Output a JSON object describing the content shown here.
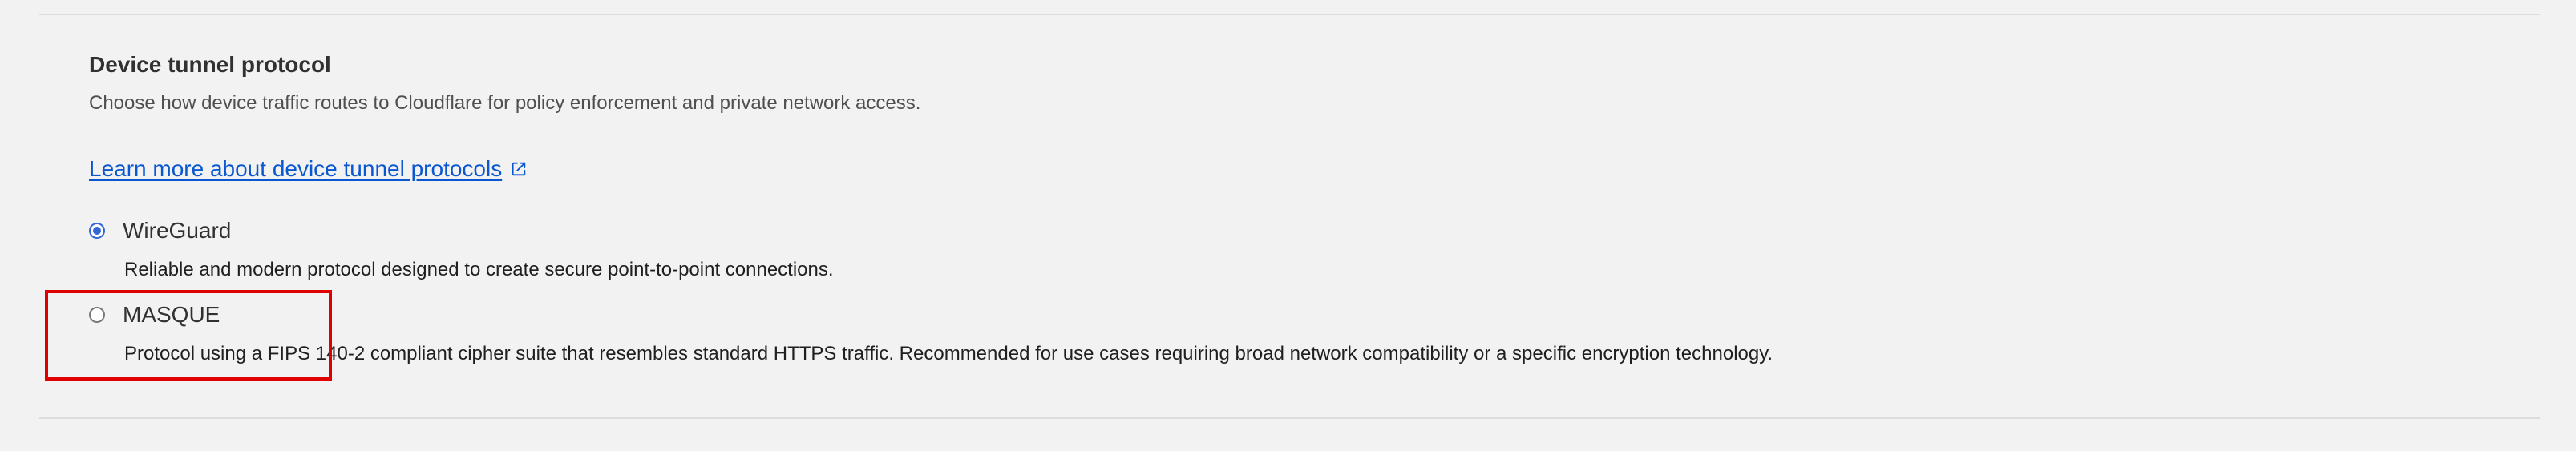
{
  "section": {
    "title": "Device tunnel protocol",
    "subtitle": "Choose how device traffic routes to Cloudflare for policy enforcement and private network access.",
    "learn_more": "Learn more about device tunnel protocols"
  },
  "options": [
    {
      "label": "WireGuard",
      "description": "Reliable and modern protocol designed to create secure point-to-point connections.",
      "selected": true
    },
    {
      "label": "MASQUE",
      "description": "Protocol using a FIPS 140-2 compliant cipher suite that resembles standard HTTPS traffic. Recommended for use cases requiring broad network compatibility or a specific encryption technology.",
      "selected": false
    }
  ],
  "icons": {
    "external_link": "external-link-icon"
  },
  "colors": {
    "link": "#0b57d0",
    "radio_selected": "#3566d6",
    "highlight": "#e00000"
  }
}
